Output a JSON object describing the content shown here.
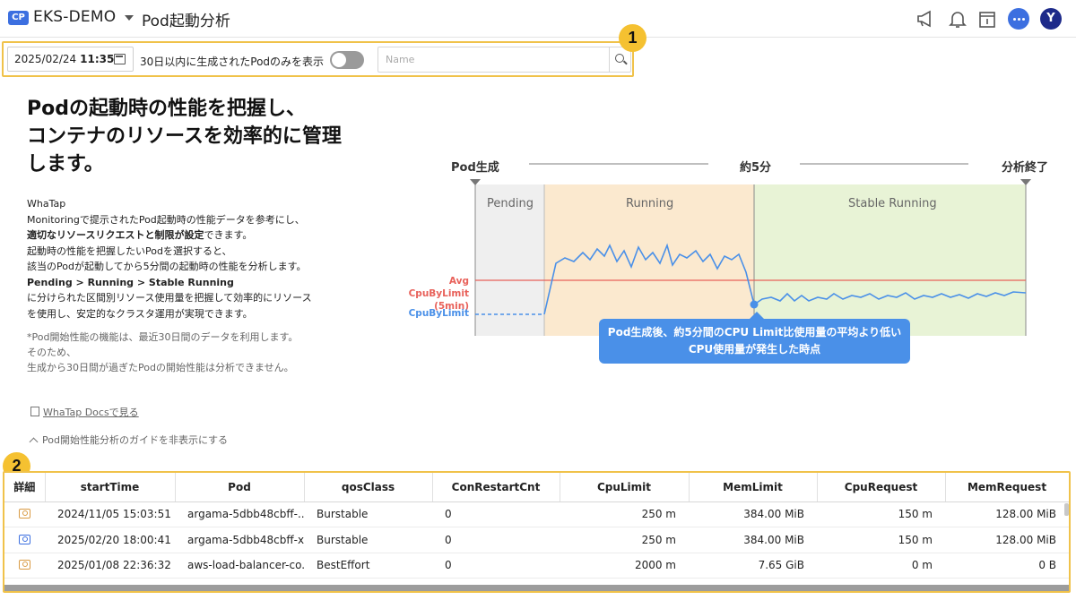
{
  "header": {
    "badge": "CP",
    "project": "EKS-DEMO",
    "title": "Pod起動分析",
    "avatar": "Y",
    "icons": [
      "megaphone-icon",
      "bell-icon",
      "calendar-icon",
      "chat-icon"
    ]
  },
  "toolbar": {
    "date": "2025/02/24",
    "time": "11:35",
    "toggle_label": "30日以内に生成されたPodのみを表示",
    "toggle_on": false,
    "search_placeholder": "Name",
    "marker": "1"
  },
  "intro": {
    "headline_lines": [
      "Podの起動時の性能を把握し、",
      "コンテナのリソースを効率的に管理",
      "します。"
    ],
    "desc": {
      "l1": "WhaTap",
      "l2": "Monitoringで提示されたPod起動時の性能データを参考にし、",
      "l3_bold": "適切なリソースリクエストと制限が設定",
      "l3_rest": "できます。",
      "l4": "起動時の性能を把握したいPodを選択すると、",
      "l5": "該当のPodが起動してから5分間の起動時の性能を分析します。",
      "l6_bold": "Pending > Running > Stable Running",
      "l7": "に分けられた区間別リソース使用量を把握して効率的にリソース",
      "l8": "を使用し、安定的なクラスタ運用が実現できます。"
    },
    "note_lines": [
      "*Pod開始性能の機能は、最近30日間のデータを利用します。",
      "そのため、",
      "生成から30日間が過ぎたPodの開始性能は分析できません。"
    ],
    "docs_link": "WhaTap Docsで見る",
    "hide_guide": "Pod開始性能分析のガイドを非表示にする"
  },
  "diagram": {
    "top_left": "Pod生成",
    "top_mid": "約5分",
    "top_right": "分析終了",
    "phases": [
      "Pending",
      "Running",
      "Stable Running"
    ],
    "avg_label_1": "Avg CpuByLimit",
    "avg_label_2": "(5min)",
    "cpu_label": "CpuByLimit",
    "callout_1": "Pod生成後、約5分間のCPU Limit比使用量の平均より低い",
    "callout_2": "CPU使用量が発生した時点",
    "colors": {
      "pending": "#efefef",
      "running": "#fbe9cf",
      "stable": "#e8f3d6",
      "line": "#4a90e8",
      "avg": "#e8615a"
    }
  },
  "table": {
    "marker": "2",
    "columns": [
      "詳細",
      "startTime",
      "Pod",
      "qosClass",
      "ConRestartCnt",
      "CpuLimit",
      "MemLimit",
      "CpuRequest",
      "MemRequest"
    ],
    "rows": [
      {
        "startTime": "2024/11/05 15:03:51",
        "pod": "argama-5dbb48cbff-...",
        "qos": "Burstable",
        "restart": "0",
        "cpuLimit": "250 m",
        "memLimit": "384.00 MiB",
        "cpuRequest": "150 m",
        "memRequest": "128.00 MiB"
      },
      {
        "startTime": "2025/02/20 18:00:41",
        "pod": "argama-5dbb48cbff-x...",
        "qos": "Burstable",
        "restart": "0",
        "cpuLimit": "250 m",
        "memLimit": "384.00 MiB",
        "cpuRequest": "150 m",
        "memRequest": "128.00 MiB"
      },
      {
        "startTime": "2025/01/08 22:36:32",
        "pod": "aws-load-balancer-co...",
        "qos": "BestEffort",
        "restart": "0",
        "cpuLimit": "2000 m",
        "memLimit": "7.65 GiB",
        "cpuRequest": "0 m",
        "memRequest": "0 B"
      }
    ]
  }
}
